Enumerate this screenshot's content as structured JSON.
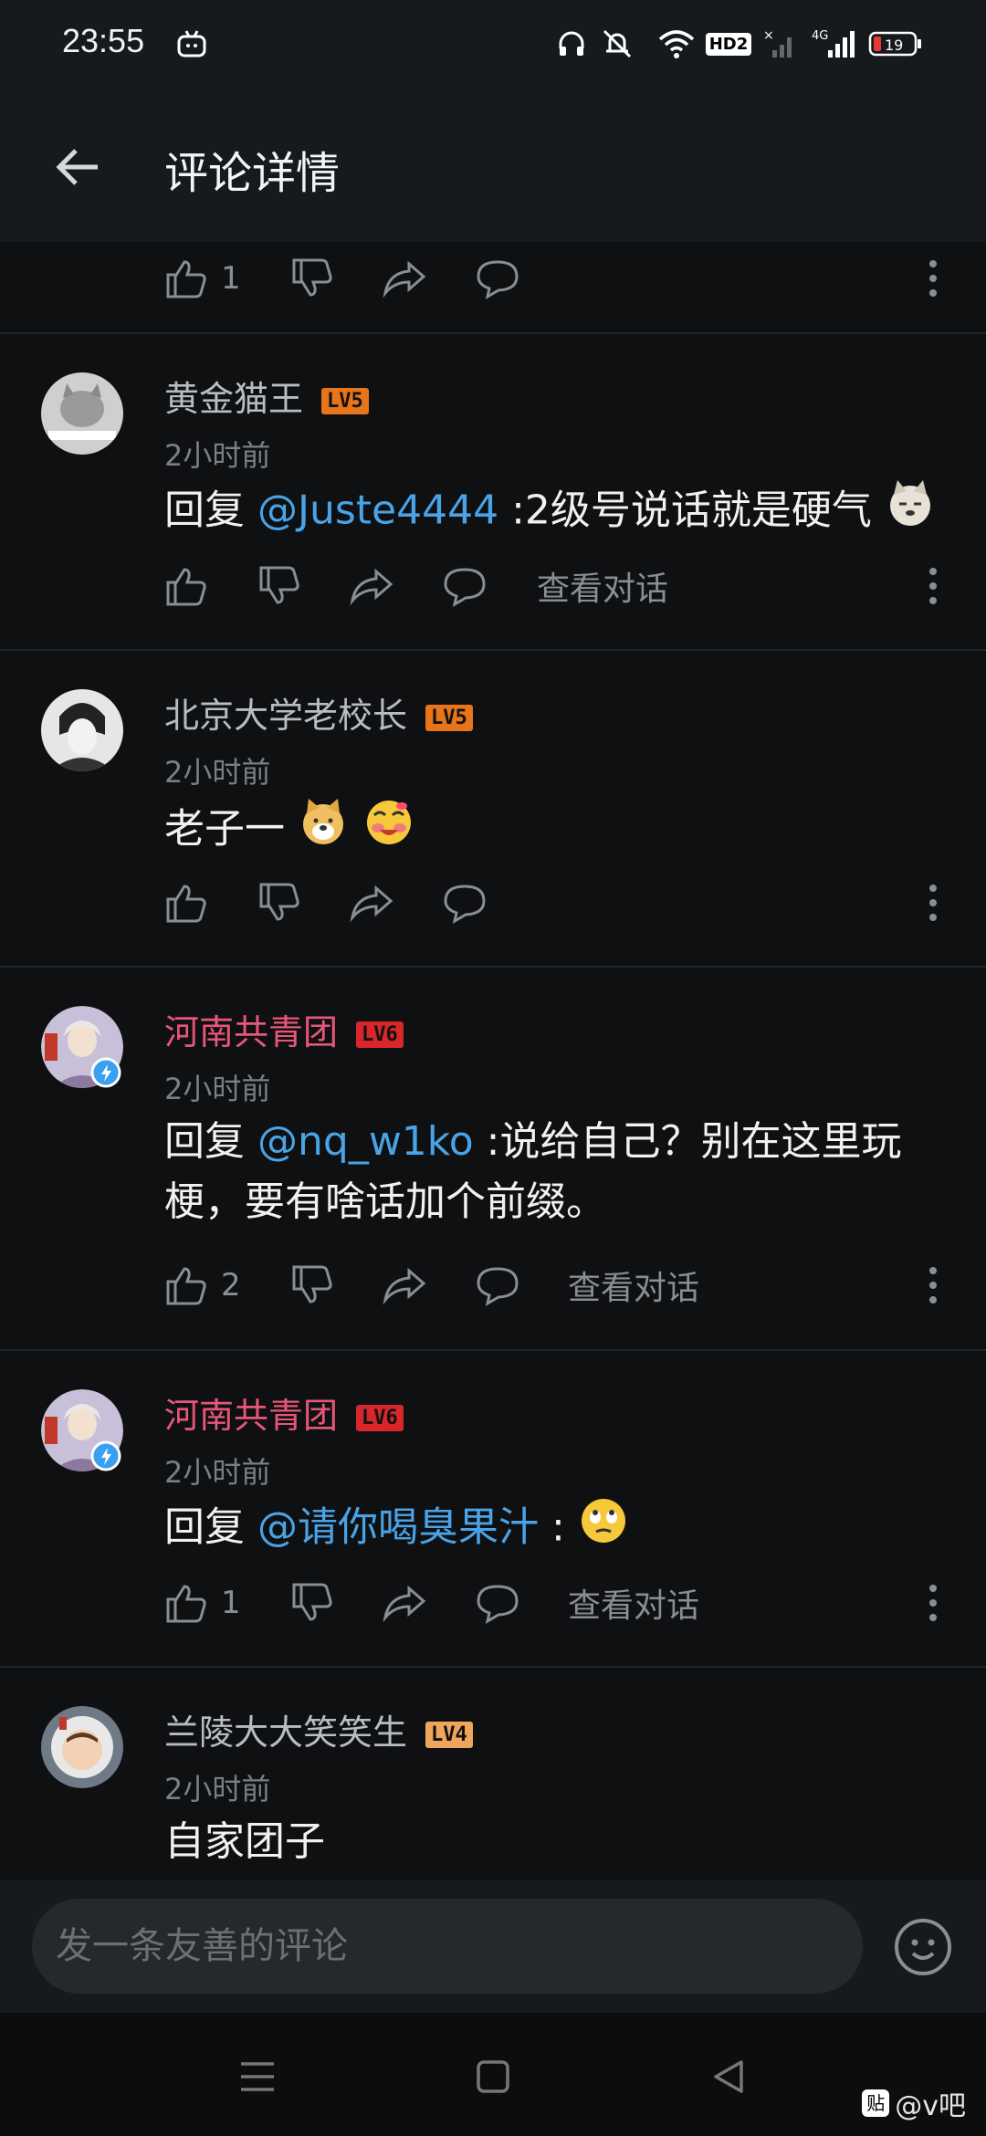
{
  "status_bar": {
    "time": "23:55",
    "hd_label": "HD2",
    "network_label": "4G",
    "battery": "19"
  },
  "header": {
    "title": "评论详情"
  },
  "first_actions": {
    "like_count": "1"
  },
  "comments": [
    {
      "username": "黄金猫王",
      "level": "LV5",
      "level_color": "#e8751a",
      "time": "2小时前",
      "prefix": "回复 ",
      "mention": "@Juste4444",
      "body": " :2级号说话就是硬气",
      "like_count": "",
      "view_conv": "查看对话"
    },
    {
      "username": "北京大学老校长",
      "level": "LV5",
      "level_color": "#e8751a",
      "time": "2小时前",
      "body": "老子一",
      "like_count": ""
    },
    {
      "username": "河南共青团",
      "level": "LV6",
      "level_color": "#d9262a",
      "name_color": "#e8567a",
      "time": "2小时前",
      "prefix": "回复 ",
      "mention": "@nq_w1ko",
      "body": " :说给自己？别在这里玩梗，要有啥话加个前缀。",
      "like_count": "2",
      "view_conv": "查看对话"
    },
    {
      "username": "河南共青团",
      "level": "LV6",
      "level_color": "#d9262a",
      "name_color": "#e8567a",
      "time": "2小时前",
      "prefix": "回复 ",
      "mention": "@请你喝臭果汁",
      "body": " :",
      "like_count": "1",
      "view_conv": "查看对话"
    },
    {
      "username": "兰陵大大笑笑生",
      "level": "LV4",
      "level_color": "#f0a55c",
      "time": "2小时前",
      "body": "自家团子"
    }
  ],
  "input": {
    "placeholder": "发一条友善的评论"
  },
  "watermark": {
    "icon": "贴",
    "text": "@v吧"
  }
}
